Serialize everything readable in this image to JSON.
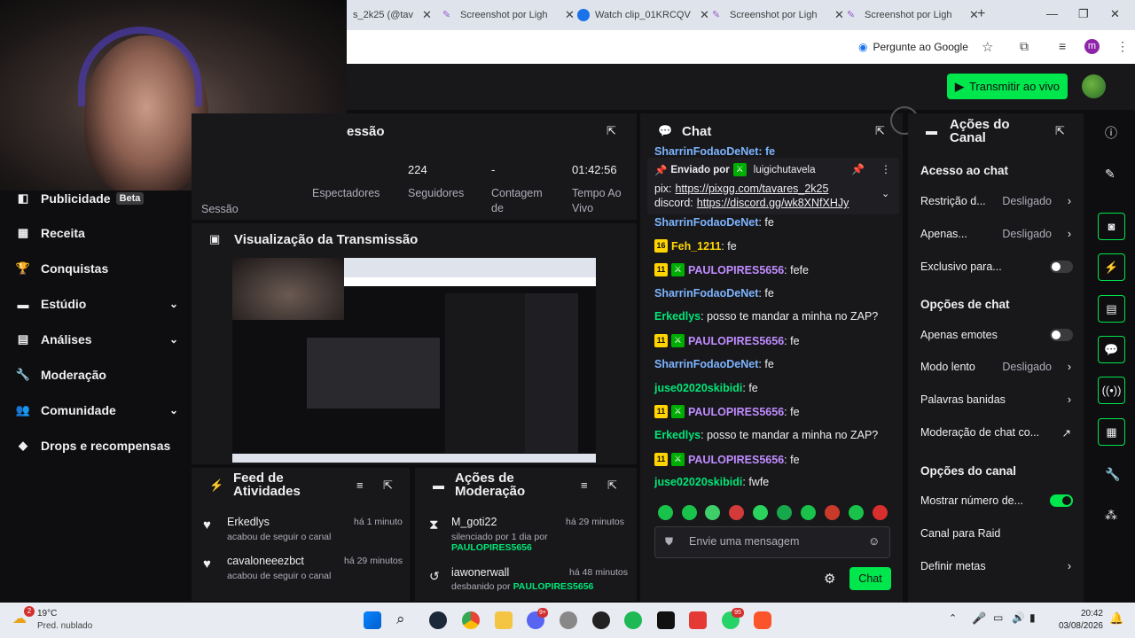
{
  "browser": {
    "tabs": [
      {
        "title": "s_2k25 (@tav"
      },
      {
        "title": "Screenshot por Ligh"
      },
      {
        "title": "Watch clip_01KRCQV"
      },
      {
        "title": "Screenshot por Ligh"
      },
      {
        "title": "Screenshot por Ligh"
      }
    ],
    "google_prompt": "Pergunte ao Google",
    "profile_initial": "m"
  },
  "header": {
    "live_button": "Transmitir ao vivo"
  },
  "sidebar": {
    "items": [
      {
        "label": "Publicidade",
        "badge": "Beta"
      },
      {
        "label": "Receita"
      },
      {
        "label": "Conquistas"
      },
      {
        "label": "Estúdio"
      },
      {
        "label": "Análises"
      },
      {
        "label": "Moderação"
      },
      {
        "label": "Comunidade"
      },
      {
        "label": "Drops e recompensas"
      }
    ]
  },
  "session": {
    "title": "essão",
    "left_label": "Sessão",
    "cols": [
      {
        "value": "",
        "label": "Espectadores"
      },
      {
        "value": "224",
        "label": "Seguidores"
      },
      {
        "value": "-",
        "label1": "Contagem",
        "label2": "de"
      },
      {
        "value": "01:42:56",
        "label1": "Tempo Ao",
        "label2": "Vivo"
      }
    ]
  },
  "preview": {
    "title": "Visualização da Transmissão"
  },
  "activity": {
    "title1": "Feed de",
    "title2": "Atividades",
    "items": [
      {
        "user": "Erkedlys",
        "action": "acabou de seguir o canal",
        "time": "há 1 minuto"
      },
      {
        "user": "cavaloneeezbct",
        "action": "acabou de seguir o canal",
        "time": "há 29 minutos"
      }
    ]
  },
  "modactions": {
    "title1": "Ações de",
    "title2": "Moderação",
    "items": [
      {
        "user": "M_goti22",
        "action": "silenciado por 1 dia por",
        "by": "PAULOPIRES5656",
        "time": "há 29 minutos"
      },
      {
        "user": "iawonerwall",
        "action": "desbanido por",
        "by": "PAULOPIRES5656",
        "time": "há 48 minutos"
      }
    ]
  },
  "chat": {
    "title": "Chat",
    "partial_top": "SharrinFodaoDeNet: fe",
    "pinned": {
      "sent_by": "Enviado por",
      "author": "luigichutavela",
      "line1_label": "pix:",
      "line1_link": "https://pixgg.com/tavares_2k25",
      "line2_label": "discord:",
      "line2_link": "https://discord.gg/wk8XNfXHJy"
    },
    "messages": [
      {
        "badge": "",
        "user": "SharrinFodaoDeNet",
        "text": "fe",
        "color": "b"
      },
      {
        "badge": "16",
        "user": "Feh_1211",
        "text": "fe",
        "color": "y"
      },
      {
        "badge": "11",
        "mod": true,
        "user": "PAULOPIRES5656",
        "text": "fefe",
        "color": "p"
      },
      {
        "badge": "",
        "user": "SharrinFodaoDeNet",
        "text": "fe",
        "color": "b"
      },
      {
        "badge": "",
        "user": "Erkedlys",
        "text": "posso te mandar a minha no ZAP?",
        "color": "g"
      },
      {
        "badge": "11",
        "mod": true,
        "user": "PAULOPIRES5656",
        "text": "fe",
        "color": "p"
      },
      {
        "badge": "",
        "user": "SharrinFodaoDeNet",
        "text": "fe",
        "color": "b"
      },
      {
        "badge": "",
        "user": "juse02020skibidi",
        "text": "fe",
        "color": "g"
      },
      {
        "badge": "11",
        "mod": true,
        "user": "PAULOPIRES5656",
        "text": "fe",
        "color": "p"
      },
      {
        "badge": "",
        "user": "Erkedlys",
        "text": "posso te mandar a minha no ZAP?",
        "color": "g"
      },
      {
        "badge": "11",
        "mod": true,
        "user": "PAULOPIRES5656",
        "text": "fe",
        "color": "p"
      },
      {
        "badge": "",
        "user": "juse02020skibidi",
        "text": "fwfe",
        "color": "g"
      }
    ],
    "input_placeholder": "Envie uma mensagem",
    "send_button": "Chat"
  },
  "actions": {
    "title1": "Ações do",
    "title2": "Canal",
    "sec1": "Acesso ao chat",
    "restrict_label": "Restrição d...",
    "restrict_value": "Desligado",
    "apenas_label": "Apenas...",
    "apenas_value": "Desligado",
    "exclusive_label": "Exclusivo para...",
    "sec2": "Opções de chat",
    "emotes_label": "Apenas emotes",
    "slow_label": "Modo lento",
    "slow_value": "Desligado",
    "banned_words": "Palavras banidas",
    "chat_mod": "Moderação de chat co...",
    "sec3": "Opções do canal",
    "show_number": "Mostrar número de...",
    "raid": "Canal para Raid",
    "goals": "Definir metas"
  },
  "taskbar": {
    "weather_temp": "19°C",
    "weather_desc": "Pred. nublado",
    "weather_badge": "2",
    "time": "20:42",
    "date": "03/08/2026",
    "discord_badge": "9+",
    "whatsapp_badge": "95"
  }
}
